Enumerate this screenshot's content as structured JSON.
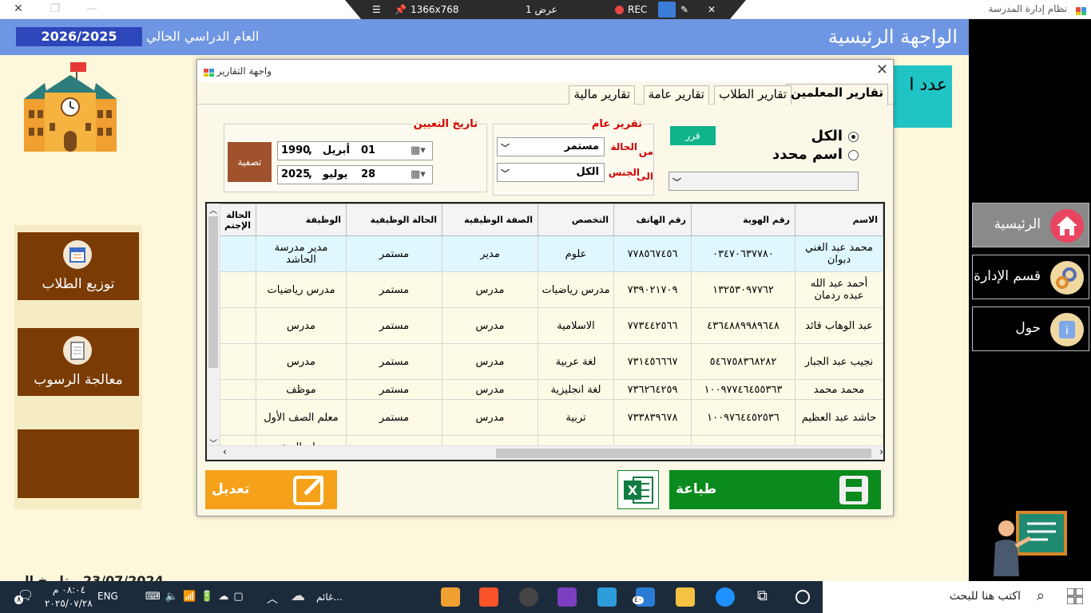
{
  "window": {
    "title": "نظام إدارة المدرسة"
  },
  "recording": {
    "resolution": "1366x768",
    "display": "عرض 1",
    "rec": "REC"
  },
  "header": {
    "title": "الواجهة الرئيسية",
    "year_label": "العام الدراسي الحالي",
    "year_value": "2026/2025"
  },
  "right_nav": [
    {
      "label": "الرئيسية",
      "icon": "home-icon"
    },
    {
      "label": "قسم الإدارة",
      "icon": "gears-icon"
    },
    {
      "label": "حول",
      "icon": "info-icon"
    }
  ],
  "left_nav": [
    {
      "label": "توزيع الطلاب",
      "icon": "calendar-icon"
    },
    {
      "label": "معالجة الرسوب",
      "icon": "clipboard-icon"
    },
    {
      "label": "",
      "icon": ""
    }
  ],
  "card": {
    "label": "عدد ا"
  },
  "bottom_strip": {
    "date_text": "23/07/2024",
    "label": "تاريخ اليو"
  },
  "dialog": {
    "title": "واجهة التقارير",
    "tabs": [
      "تقارير المعلمين",
      "تقارير الطلاب",
      "تقارير عامة",
      "تقارير مالية"
    ],
    "radio_all": "الكل",
    "radio_name": "اسم محدد",
    "decide_button": "قرر",
    "general": {
      "title": "تقرير عام",
      "status_label": "الحالة",
      "status_value": "مستمر",
      "gender_label": "الجنس",
      "gender_value": "الكل"
    },
    "appointment": {
      "title": "تاريخ التعيين",
      "from_label": "من",
      "to_label": "الى",
      "from": {
        "day": "01",
        "month": "أبريل",
        "year": "1990"
      },
      "to": {
        "day": "28",
        "month": "يوليو",
        "year": "2025"
      },
      "filter_button": "تصفية"
    },
    "print_button": "طباعة",
    "edit_button": "تعديل",
    "columns": [
      "الاسم",
      "رقم الهوية",
      "رقم الهاتف",
      "التخصص",
      "الصفة الوظيفية",
      "الحالة الوظيفية",
      "الوظيفة",
      "الحالة الإجتم"
    ],
    "rows": [
      [
        "محمد عبد الغني دبوان",
        "٠٣٤٧٠٦٣٧٧٨٠",
        "٧٧٨٥٦٧٤٥٦",
        "علوم",
        "مدير",
        "مستمر",
        "مدير مدرسة الحاشد",
        ""
      ],
      [
        "أحمد عبد الله عبده ردمان",
        "١٣٢٥٣٠٩٧٧٦٢",
        "٧٣٩٠٢١٧٠٩",
        "مدرس رياضيات",
        "مدرس",
        "مستمر",
        "مدرس رياضيات",
        ""
      ],
      [
        "عبد الوهاب قائد",
        "٤٣٦٤٨٨٩٩٨٩٦٤٨",
        "٧٧٣٤٤٢٥٦٦",
        "الاسلامية",
        "مدرس",
        "مستمر",
        "مدرس",
        ""
      ],
      [
        "نجيب عبد الجبار",
        "٥٤٦٧٥٨٣٦٨٢٨٢",
        "٧٣١٤٥٦٦٦٧",
        "لغة عربية",
        "مدرس",
        "مستمر",
        "مدرس",
        ""
      ],
      [
        "محمد محمد",
        "١٠٠٩٧٧٤٦٤٥٥٣٦٣",
        "٧٣٦٢٦٤٢٥٩",
        "لغة انجليزية",
        "مدرس",
        "مستمر",
        "موظف",
        ""
      ],
      [
        "حاشد عبد العظيم",
        "١٠٠٩٧٦٤٤٥٢٥٣٦",
        "٧٣٣٨٣٩٦٧٨",
        "تربية",
        "مدرس",
        "مستمر",
        "معلم الصف الأول",
        ""
      ],
      [
        "",
        "",
        "",
        "",
        "",
        "",
        "معلم الصف",
        ""
      ]
    ]
  },
  "taskbar": {
    "search_placeholder": "اكتب هنا للبحث",
    "weather": "غائم...",
    "lang": "ENG",
    "time": "٠٨:٠٤ م",
    "date": "٢٠٢٥/٠٧/٢٨",
    "badge": "٤٠",
    "notif": "٨"
  }
}
